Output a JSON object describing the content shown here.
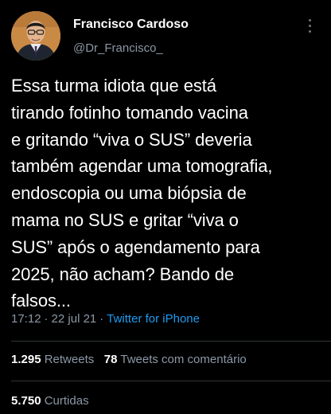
{
  "author": {
    "name": "Francisco Cardoso",
    "handle": "@Dr_Francisco_"
  },
  "tweet": {
    "text": "Essa turma idiota que está\ntirando fotinho tomando vacina\ne gritando “viva o SUS” deveria\ntambém agendar uma tomografia,\nendoscopia ou uma biópsia de\nmama no SUS e gritar “viva  o\nSUS” após o agendamento para\n2025, não acham? Bando de\nfalsos...",
    "time": "17:12",
    "date": "22 jul 21",
    "separator": "·",
    "source": "Twitter for iPhone"
  },
  "stats": {
    "retweets_count": "1.295",
    "retweets_label": "Retweets",
    "quotes_count": "78",
    "quotes_label": "Tweets com comentário",
    "likes_count": "5.750",
    "likes_label": "Curtidas"
  },
  "colors": {
    "background": "#000000",
    "primary_text": "#ffffff",
    "secondary_text": "#8b98a5",
    "link": "#1d9bf0",
    "divider": "#2f3336"
  },
  "icons": {
    "more": "more-vertical-icon",
    "avatar": "profile-photo"
  }
}
